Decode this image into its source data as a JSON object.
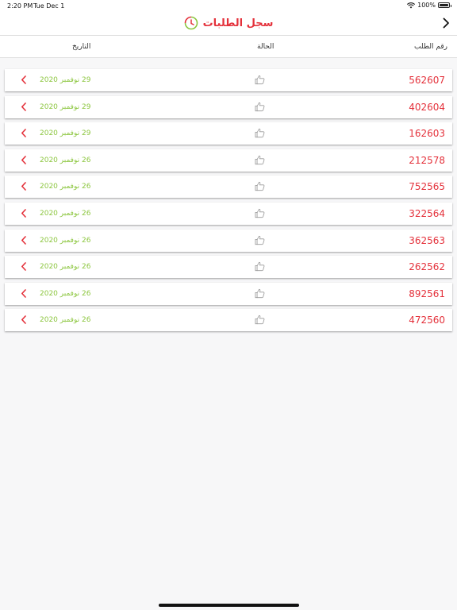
{
  "status_bar": {
    "time": "2:20 PM",
    "date": "Tue Dec 1",
    "battery": "100%"
  },
  "header": {
    "title": "سجل الطلبات"
  },
  "columns": {
    "order_number": "رقم الطلب",
    "status": "الحالة",
    "date": "التاريخ"
  },
  "orders": [
    {
      "number": "562607",
      "date": "29 نوفمبر 2020"
    },
    {
      "number": "402604",
      "date": "29 نوفمبر 2020"
    },
    {
      "number": "162603",
      "date": "29 نوفمبر 2020"
    },
    {
      "number": "212578",
      "date": "26 نوفمبر 2020"
    },
    {
      "number": "752565",
      "date": "26 نوفمبر 2020"
    },
    {
      "number": "322564",
      "date": "26 نوفمبر 2020"
    },
    {
      "number": "362563",
      "date": "26 نوفمبر 2020"
    },
    {
      "number": "262562",
      "date": "26 نوفمبر 2020"
    },
    {
      "number": "892561",
      "date": "26 نوفمبر 2020"
    },
    {
      "number": "472560",
      "date": "26 نوفمبر 2020"
    }
  ],
  "colors": {
    "accent": "#e4313b",
    "date_green": "#8cc63f"
  },
  "icons": {
    "back": "chevron-right-icon",
    "title": "clock-icon",
    "status": "thumbs-up-icon",
    "row_action": "chevron-left-icon"
  }
}
